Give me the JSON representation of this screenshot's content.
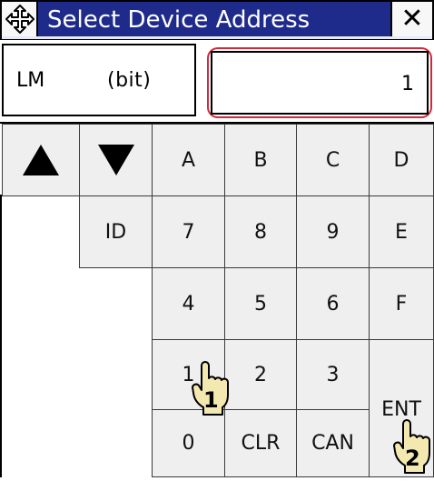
{
  "dialog": {
    "title": "Select Device Address",
    "close_glyph": "✕"
  },
  "device": {
    "name": "LM",
    "type": "(bit)"
  },
  "address_value": "1",
  "keypad": {
    "up_icon": "triangle-up-icon",
    "down_icon": "triangle-down-icon",
    "keys": {
      "a": "A",
      "b": "B",
      "c": "C",
      "d": "D",
      "id": "ID",
      "k7": "7",
      "k8": "8",
      "k9": "9",
      "e": "E",
      "k4": "4",
      "k5": "5",
      "k6": "6",
      "f": "F",
      "k1": "1",
      "k2": "2",
      "k3": "3",
      "ent": "ENT",
      "k0": "0",
      "clr": "CLR",
      "can": "CAN"
    }
  },
  "annotations": {
    "step1": "1",
    "step2": "2"
  },
  "colors": {
    "title_bar": "#1f2b8b",
    "highlight_border": "#d3283a",
    "key_fill": "#efefef"
  }
}
